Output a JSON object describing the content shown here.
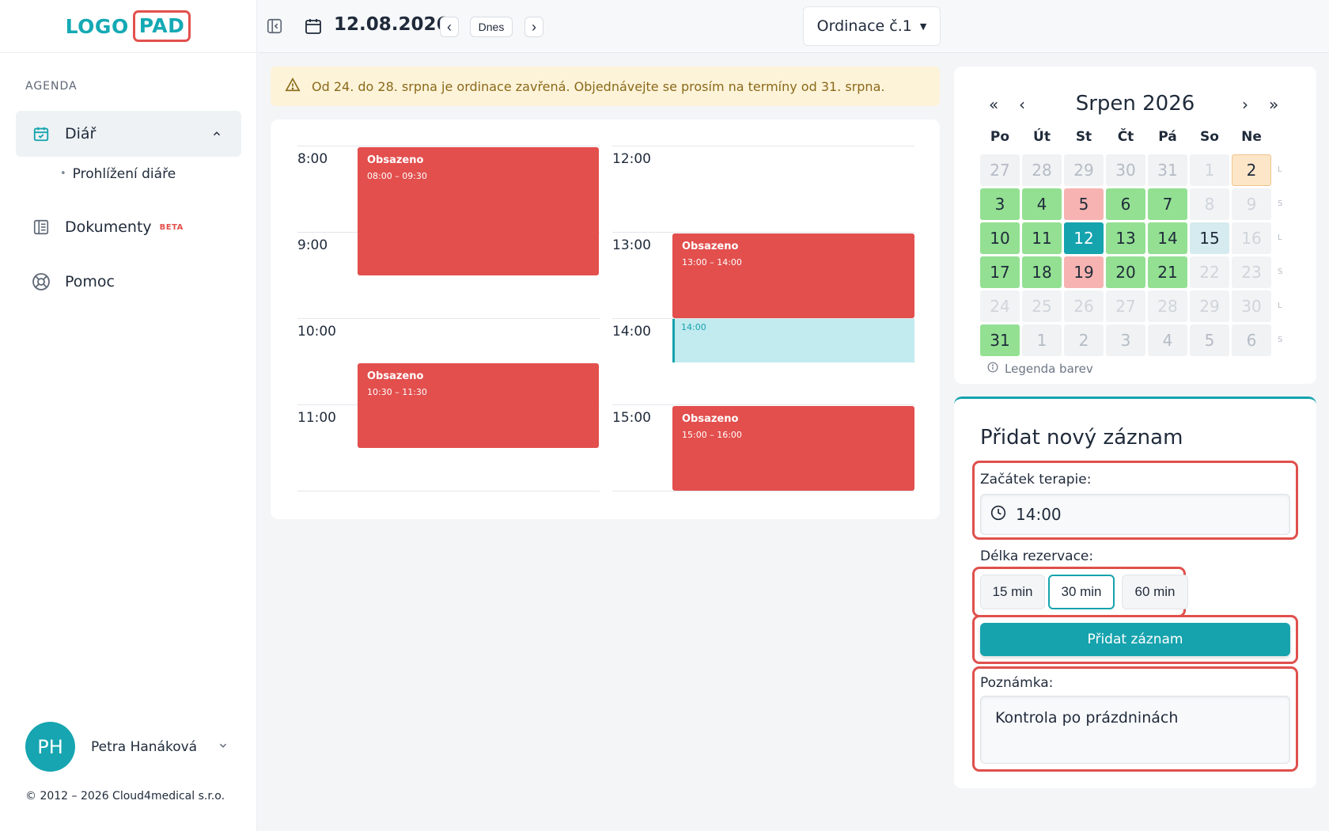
{
  "logo": {
    "part1": "LOGO",
    "part2": "PAD"
  },
  "sidebar": {
    "section": "AGENDA",
    "items": [
      {
        "label": "Diář",
        "icon": "calendar-check-icon"
      },
      {
        "label": "Prohlížení diáře"
      },
      {
        "label": "Dokumenty",
        "badge": "BETA",
        "icon": "document-icon"
      },
      {
        "label": "Pomoc",
        "icon": "lifebuoy-icon"
      }
    ],
    "user": {
      "initials": "PH",
      "name": "Petra Hanáková"
    },
    "copyright": "© 2012 – 2026 Cloud4medical s.r.o."
  },
  "header": {
    "date": "12.08.2026",
    "today_label": "Dnes",
    "prev": "‹",
    "next": "›",
    "room": "Ordinace č.1"
  },
  "alert": {
    "text": "Od 24. do 28. srpna je ordinace zavřená. Objednávejte se prosím na termíny od 31. srpna."
  },
  "schedule": {
    "times": [
      "8:00",
      "9:00",
      "10:00",
      "11:00",
      "12:00",
      "13:00",
      "14:00",
      "15:00"
    ],
    "events": [
      {
        "title": "Obsazeno",
        "time": "08:00 – 09:30"
      },
      {
        "title": "Obsazeno",
        "time": "10:30 – 11:30"
      },
      {
        "title": "Obsazeno",
        "time": "13:00 – 14:00"
      },
      {
        "title": "Obsazeno",
        "time": "15:00 – 16:00"
      }
    ],
    "selected": "14:00"
  },
  "calendar": {
    "title": "Srpen 2026",
    "nav": {
      "first": "«",
      "prev": "‹",
      "next": "›",
      "last": "»"
    },
    "days_of_week": [
      "Po",
      "Út",
      "St",
      "Čt",
      "Pá",
      "So",
      "Ne"
    ],
    "rows": [
      {
        "days": [
          "27",
          "28",
          "29",
          "30",
          "31",
          "1",
          "2"
        ],
        "tag": "L"
      },
      {
        "days": [
          "3",
          "4",
          "5",
          "6",
          "7",
          "8",
          "9"
        ],
        "tag": "S"
      },
      {
        "days": [
          "10",
          "11",
          "12",
          "13",
          "14",
          "15",
          "16"
        ],
        "tag": "L"
      },
      {
        "days": [
          "17",
          "18",
          "19",
          "20",
          "21",
          "22",
          "23"
        ],
        "tag": "S"
      },
      {
        "days": [
          "24",
          "25",
          "26",
          "27",
          "28",
          "29",
          "30"
        ],
        "tag": "L"
      },
      {
        "days": [
          "31",
          "1",
          "2",
          "3",
          "4",
          "5",
          "6"
        ],
        "tag": "S"
      }
    ],
    "legend": "Legenda barev"
  },
  "form": {
    "title": "Přidat nový záznam",
    "start_label": "Začátek terapie:",
    "start_value": "14:00",
    "duration_label": "Délka rezervace:",
    "durations": [
      "15 min",
      "30 min",
      "60 min"
    ],
    "selected_duration": "30 min",
    "submit": "Přidat záznam",
    "note_label": "Poznámka:",
    "note_value": "Kontrola po prázdninách"
  },
  "colors": {
    "accent": "#15a3ae",
    "busy": "#e24f4d",
    "highlight": "#e0504c",
    "available": "#93e092"
  }
}
